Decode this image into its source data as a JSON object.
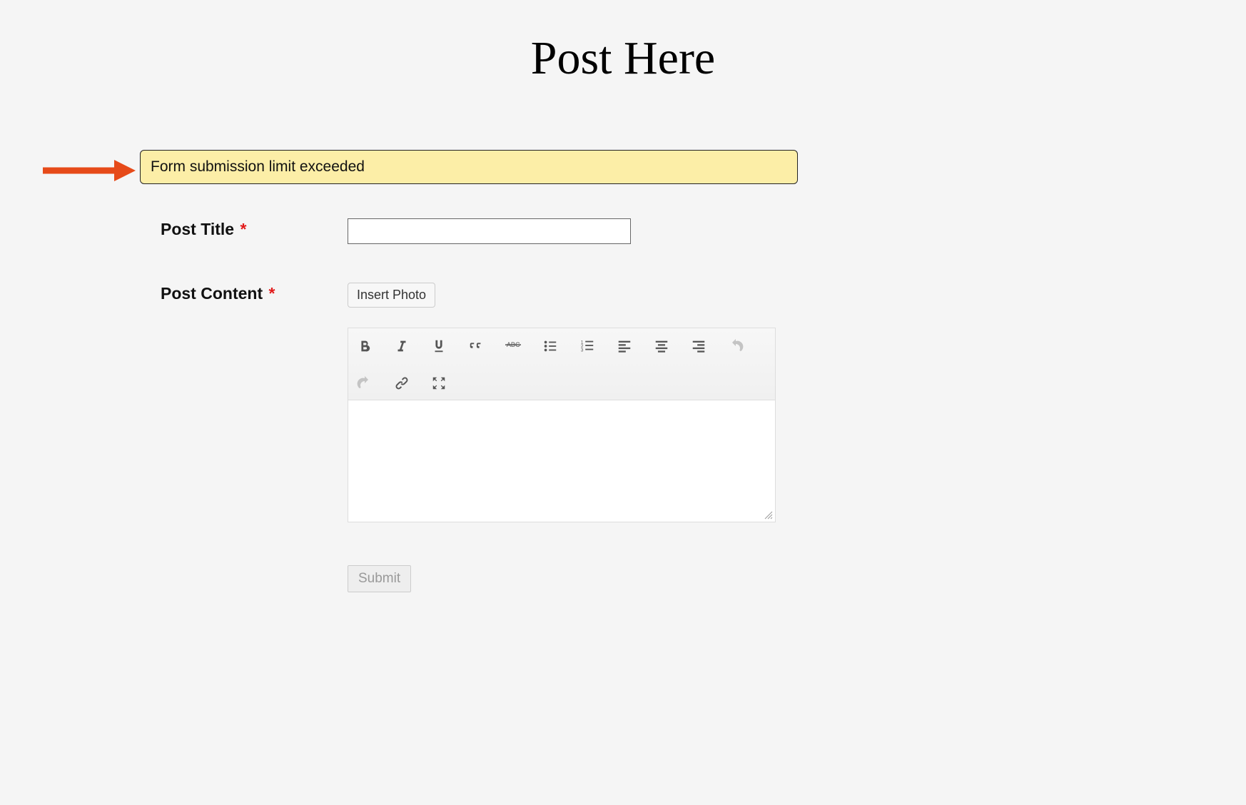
{
  "heading": "Post Here",
  "alert": {
    "message": "Form submission limit exceeded"
  },
  "fields": {
    "title": {
      "label": "Post Title",
      "required_marker": "*",
      "value": ""
    },
    "content": {
      "label": "Post Content",
      "required_marker": "*",
      "insert_photo_label": "Insert Photo"
    }
  },
  "toolbar": {
    "icons": [
      "bold-icon",
      "italic-icon",
      "underline-icon",
      "blockquote-icon",
      "strikethrough-icon",
      "bullet-list-icon",
      "numbered-list-icon",
      "align-left-icon",
      "align-center-icon",
      "align-right-icon",
      "undo-icon",
      "redo-icon",
      "link-icon",
      "fullscreen-icon"
    ]
  },
  "submit": {
    "label": "Submit"
  }
}
